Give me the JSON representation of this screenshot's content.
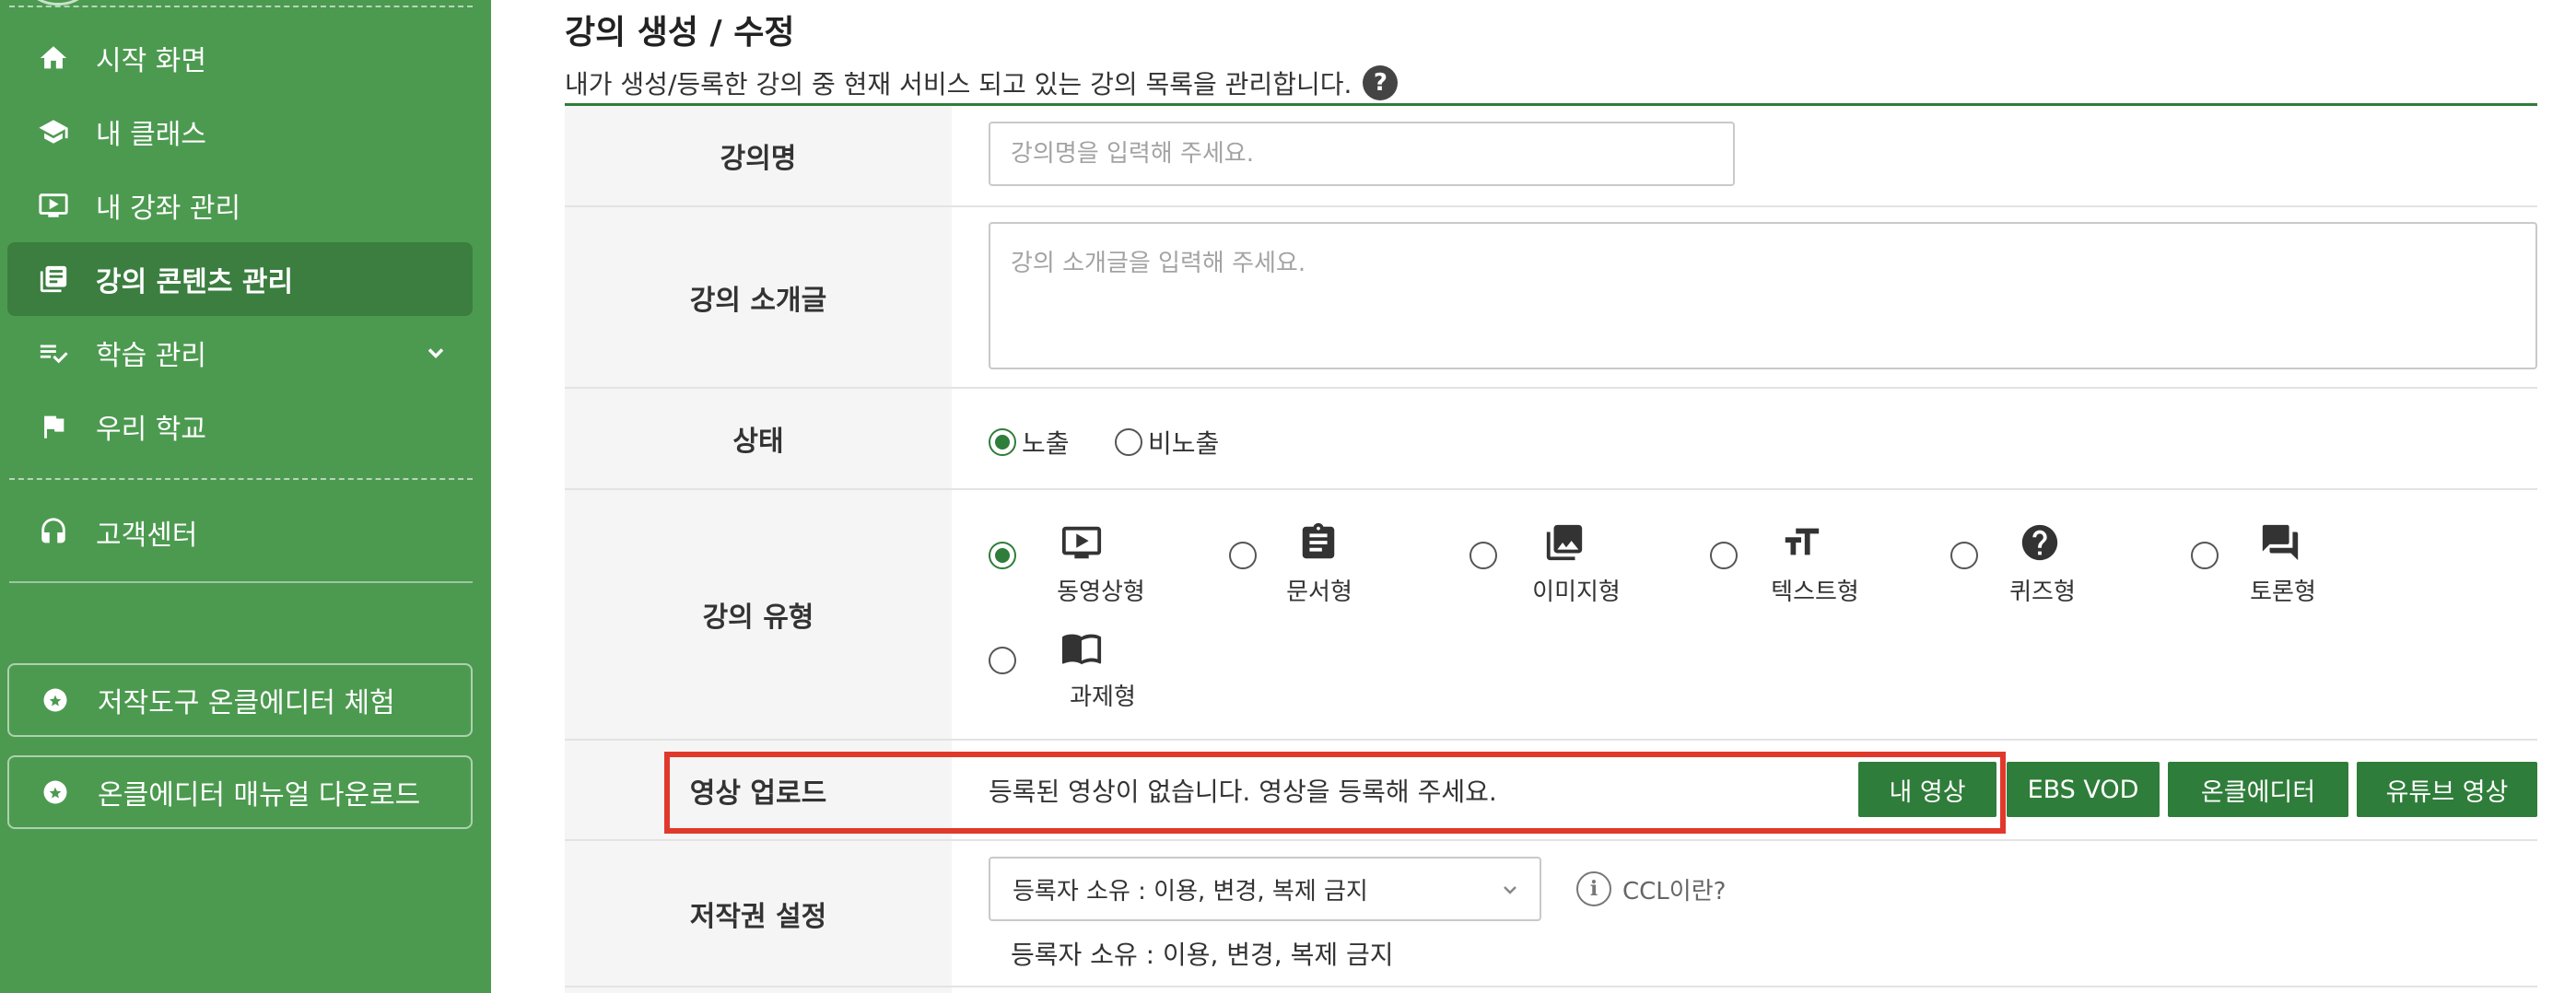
{
  "sidebar": {
    "nav": [
      {
        "label": "시작 화면",
        "icon": "home-icon"
      },
      {
        "label": "내 클래스",
        "icon": "graduation-cap-icon"
      },
      {
        "label": "내 강좌 관리",
        "icon": "video-screen-icon"
      },
      {
        "label": "강의 콘텐츠 관리",
        "icon": "library-books-icon",
        "active": true
      },
      {
        "label": "학습 관리",
        "icon": "playlist-check-icon",
        "expandable": true
      },
      {
        "label": "우리 학교",
        "icon": "flag-icon"
      }
    ],
    "support": {
      "label": "고객센터",
      "icon": "headset-icon"
    },
    "buttons": [
      {
        "label": "저작도구 온클에디터 체험",
        "icon": "star-badge-icon"
      },
      {
        "label": "온클에디터 매뉴얼 다운로드",
        "icon": "star-badge-icon"
      }
    ]
  },
  "page": {
    "title": "강의 생성 / 수정",
    "description": "내가 생성/등록한 강의 중 현재 서비스 되고 있는 강의 목록을 관리합니다.",
    "help": "?"
  },
  "form": {
    "name": {
      "label": "강의명",
      "placeholder": "강의명을 입력해 주세요.",
      "value": ""
    },
    "intro": {
      "label": "강의 소개글",
      "placeholder": "강의 소개글을 입력해 주세요.",
      "value": ""
    },
    "status": {
      "label": "상태",
      "options": [
        "노출",
        "비노출"
      ],
      "selected": "노출"
    },
    "type": {
      "label": "강의 유형",
      "options": [
        {
          "label": "동영상형",
          "icon": "video-play-icon"
        },
        {
          "label": "문서형",
          "icon": "clipboard-icon"
        },
        {
          "label": "이미지형",
          "icon": "image-stack-icon"
        },
        {
          "label": "텍스트형",
          "icon": "text-size-icon"
        },
        {
          "label": "퀴즈형",
          "icon": "question-circle-icon"
        },
        {
          "label": "토론형",
          "icon": "forum-icon"
        },
        {
          "label": "과제형",
          "icon": "open-book-icon"
        }
      ],
      "selected": "동영상형"
    },
    "upload": {
      "label": "영상 업로드",
      "message": "등록된 영상이 없습니다. 영상을 등록해 주세요.",
      "buttons": [
        "내 영상",
        "EBS VOD",
        "온클에디터",
        "유튜브 영상"
      ]
    },
    "copyright": {
      "label": "저작권 설정",
      "selected": "등록자 소유 : 이용, 변경, 복제 금지",
      "info_label": "CCL이란?",
      "info_icon": "i",
      "description": "등록자 소유 : 이용, 변경, 복제 금지"
    }
  },
  "colors": {
    "sidebar_bg": "#4c9a50",
    "sidebar_active": "#3b7e40",
    "accent_green": "#2f7d3a",
    "highlight_red": "#e0392b"
  }
}
